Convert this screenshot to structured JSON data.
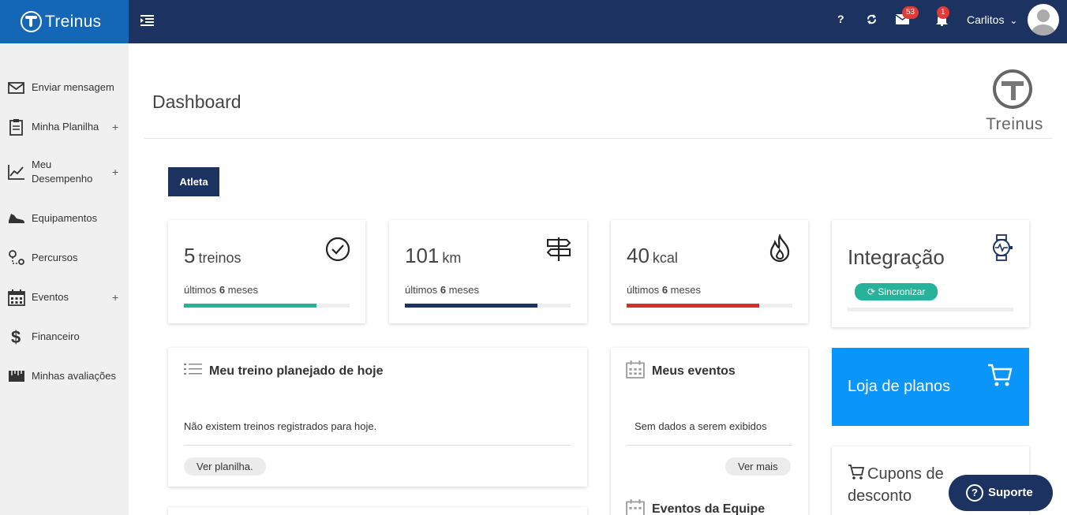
{
  "brand": {
    "name": "Treinus"
  },
  "header": {
    "help_label": "?",
    "messages_count": "53",
    "notifications_count": "1",
    "user_name": "Carlitos",
    "user_chevron": "⌄"
  },
  "sidebar": {
    "items": [
      {
        "label": "Enviar mensagem",
        "icon": "envelope-icon",
        "expandable": false
      },
      {
        "label": "Minha Planilha",
        "icon": "clipboard-icon",
        "expandable": true
      },
      {
        "label": "Meu Desempenho",
        "icon": "line-chart-icon",
        "expandable": true
      },
      {
        "label": "Equipamentos",
        "icon": "shoe-icon",
        "expandable": false
      },
      {
        "label": "Percursos",
        "icon": "route-icon",
        "expandable": false
      },
      {
        "label": "Eventos",
        "icon": "calendar-icon",
        "expandable": true
      },
      {
        "label": "Financeiro",
        "icon": "dollar-icon",
        "expandable": false
      },
      {
        "label": "Minhas avaliações",
        "icon": "ruler-icon",
        "expandable": false
      }
    ],
    "plus": "+"
  },
  "main": {
    "title": "Dashboard",
    "tab": "Atleta"
  },
  "stats": [
    {
      "value": "5",
      "unit": "treinos",
      "sub_prefix": "últimos",
      "sub_num": "6",
      "sub_suffix": "meses",
      "progress": 0.8,
      "color": "#26b39a",
      "icon": "check-circle-icon"
    },
    {
      "value": "101",
      "unit": "km",
      "sub_prefix": "últimos",
      "sub_num": "6",
      "sub_suffix": "meses",
      "progress": 0.8,
      "color": "#1c3260",
      "icon": "signpost-icon"
    },
    {
      "value": "40",
      "unit": "kcal",
      "sub_prefix": "últimos",
      "sub_num": "6",
      "sub_suffix": "meses",
      "progress": 0.8,
      "color": "#d32f2f",
      "icon": "flame-icon"
    }
  ],
  "integration": {
    "title": "Integração",
    "sync_label": "Sincronizar",
    "icon": "smartwatch-icon"
  },
  "today_training": {
    "title": "Meu treino planejado de hoje",
    "empty_text": "Não existem treinos registrados para hoje.",
    "button": "Ver planilha."
  },
  "events": {
    "title": "Meus eventos",
    "empty_text": "Sem dados a serem exibidos",
    "button": "Ver mais",
    "team_title": "Eventos da Equipe"
  },
  "store": {
    "label": "Loja de planos",
    "icon": "cart-icon"
  },
  "coupons": {
    "title": "Cupons de desconto"
  },
  "support": {
    "label": "Suporte"
  },
  "colors": {
    "topbar": "#1c3260",
    "brand": "#1467b7",
    "store": "#0a95fb",
    "sync": "#26b39a"
  }
}
